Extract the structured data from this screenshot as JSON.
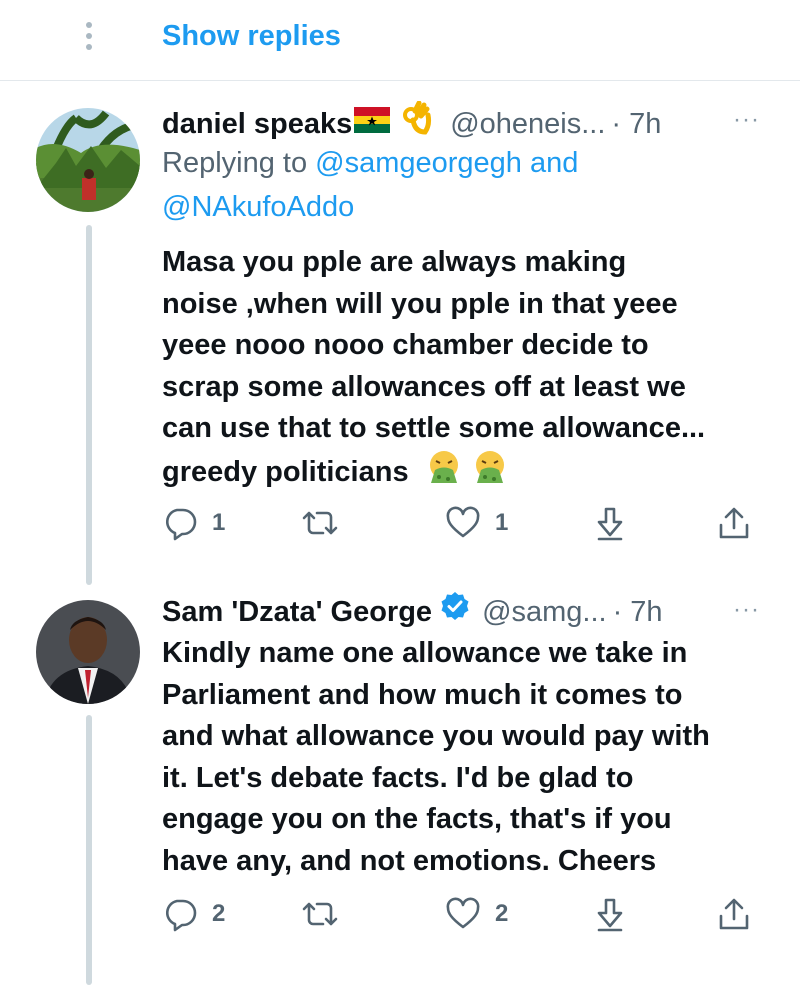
{
  "top": {
    "show_replies": "Show replies"
  },
  "tweets": [
    {
      "name": "daniel speaks",
      "handle": "@oheneis...",
      "time": "· 7h",
      "more": "···",
      "replying_prefix": "Replying to ",
      "replying_user1": "@samgeorgegh",
      "replying_and": " and",
      "replying_user2": "@NAkufoAddo",
      "text_lines": [
        "Masa you pple are always making",
        "noise ,when will you pple in that yeee",
        "yeee nooo nooo chamber decide to",
        "scrap some allowances off at least we",
        "can use that to settle some allowance...",
        "greedy politicians"
      ],
      "reply_count": "1",
      "like_count": "1"
    },
    {
      "name": "Sam 'Dzata' George",
      "handle": "@samg...",
      "time": "· 7h",
      "more": "···",
      "text_lines": [
        "Kindly name one allowance we take in",
        "Parliament and how much it comes to",
        "and what allowance you would pay with",
        "it. Let's debate facts. I'd be glad to",
        "engage you on the facts, that's if you",
        "have any, and not emotions. Cheers"
      ],
      "reply_count": "2",
      "like_count": "2"
    }
  ],
  "icons": [
    "reply-icon",
    "retweet-icon",
    "like-icon",
    "download-icon",
    "share-icon",
    "verified-icon",
    "ghana-flag-icon",
    "ok-hand-icon",
    "vomit-emoji-icon"
  ],
  "colors": {
    "link": "#1d9bf0",
    "secondary": "#536471",
    "thread": "#cfd9de"
  }
}
